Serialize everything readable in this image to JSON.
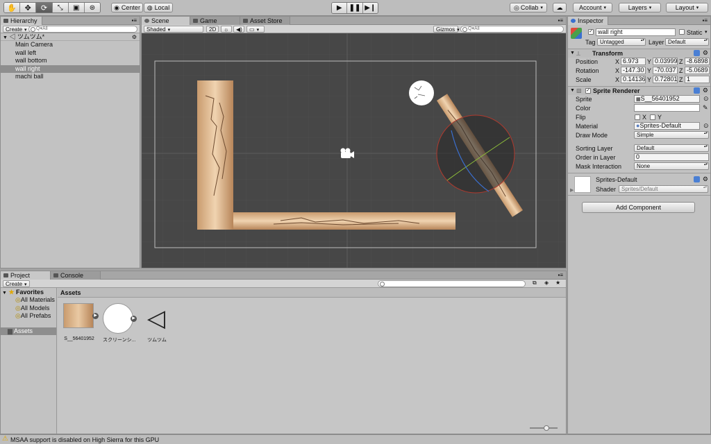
{
  "toolbar": {
    "tools": [
      "hand-tool",
      "move-tool",
      "rotate-tool",
      "scale-tool",
      "rect-tool",
      "transform-tool"
    ],
    "pivot": "Center",
    "space": "Local",
    "collab": "Collab",
    "account": "Account",
    "layers": "Layers",
    "layout": "Layout"
  },
  "hierarchy": {
    "tab": "Hierarchy",
    "create": "Create",
    "search": "Q▾All",
    "scene": "ツムツム*",
    "items": [
      "Main Camera",
      "wall left",
      "wall bottom",
      "wall right",
      "machi ball"
    ]
  },
  "sceneview": {
    "tabs": [
      "Scene",
      "Game",
      "Asset Store"
    ],
    "shading": "Shaded",
    "mode2d": "2D",
    "gizmos": "Gizmos",
    "search": "Q▾All"
  },
  "inspector": {
    "tab": "Inspector",
    "object_name": "wall right",
    "static_label": "Static",
    "tag_label": "Tag",
    "tag_value": "Untagged",
    "layer_label": "Layer",
    "layer_value": "Default",
    "transform": {
      "title": "Transform",
      "position_label": "Position",
      "rotation_label": "Rotation",
      "scale_label": "Scale",
      "position": [
        "6.973",
        "0.03999",
        "-8.6898"
      ],
      "rotation": [
        "-147.30",
        "-70.037",
        "-5.0689"
      ],
      "scale": [
        "0.14136",
        "0.72801",
        "1"
      ]
    },
    "sprite_renderer": {
      "title": "Sprite Renderer",
      "sprite_label": "Sprite",
      "sprite_value": "S__56401952",
      "color_label": "Color",
      "flip_label": "Flip",
      "flip_x": "X",
      "flip_y": "Y",
      "material_label": "Material",
      "material_value": "Sprites-Default",
      "draw_mode_label": "Draw Mode",
      "draw_mode_value": "Simple",
      "sorting_layer_label": "Sorting Layer",
      "sorting_layer_value": "Default",
      "order_label": "Order in Layer",
      "order_value": "0",
      "mask_label": "Mask Interaction",
      "mask_value": "None"
    },
    "material": {
      "name": "Sprites-Default",
      "shader_label": "Shader",
      "shader_value": "Sprites/Default"
    },
    "add_component": "Add Component"
  },
  "project": {
    "tabs": [
      "Project",
      "Console"
    ],
    "create": "Create",
    "favorites_label": "Favorites",
    "favorites": [
      "All Materials",
      "All Models",
      "All Prefabs"
    ],
    "assets_label": "Assets",
    "breadcrumb": "Assets",
    "assets": [
      "S__56401952",
      "スクリーンシ...",
      "ツムツム"
    ]
  },
  "status": {
    "message": "MSAA support is disabled on High Sierra for this GPU"
  },
  "colors": {
    "scene_bg": "#474747",
    "selection": "#8e8e8e",
    "warning": "#f5c400"
  }
}
